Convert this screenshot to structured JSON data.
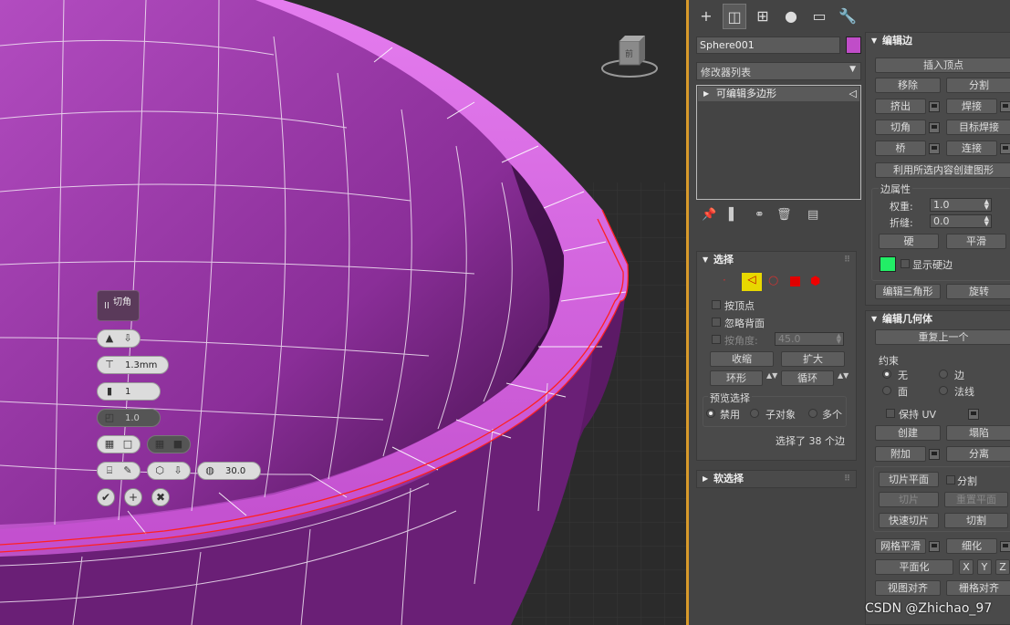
{
  "viewport": {
    "caddy_title": "切角",
    "caddy_pause": "II",
    "amount_value": "1.3mm",
    "segments_value": "1",
    "tension_value": "1.0",
    "threshold_value": "30.0",
    "nav_cube_label": "前"
  },
  "tabs": [
    "+",
    "修改",
    "层次",
    "运动",
    "显示",
    "工具"
  ],
  "object": {
    "name": "Sphere001",
    "color": "#c04dc8"
  },
  "modifier_list": {
    "label": "修改器列表"
  },
  "stack": {
    "item": "可编辑多边形"
  },
  "edit_edges": {
    "title": "编辑边",
    "insert_vertex": "插入顶点",
    "remove": "移除",
    "split": "分割",
    "extrude": "挤出",
    "weld": "焊接",
    "chamfer": "切角",
    "target_weld": "目标焊接",
    "bridge": "桥",
    "connect": "连接",
    "create_shape": "利用所选内容创建图形",
    "edge_props": "边属性",
    "weight_label": "权重:",
    "weight_value": "1.0",
    "crease_label": "折缝:",
    "crease_value": "0.0",
    "hard": "硬",
    "smooth": "平滑",
    "display_hard": "显示硬边",
    "hard_color": "#22ee66",
    "edit_tri": "编辑三角形",
    "turn": "旋转"
  },
  "edit_geometry": {
    "title": "编辑几何体",
    "repeat_last": "重复上一个",
    "constraints": "约束",
    "c_none": "无",
    "c_edge": "边",
    "c_face": "面",
    "c_normal": "法线",
    "preserve_uv": "保持 UV",
    "create": "创建",
    "collapse": "塌陷",
    "attach": "附加",
    "detach": "分离",
    "slice_plane": "切片平面",
    "split": "分割",
    "slice": "切片",
    "reset_plane": "重置平面",
    "quickslice": "快速切片",
    "cut": "切割",
    "meshsmooth": "网格平滑",
    "tessellate": "细化",
    "make_planar": "平面化",
    "x": "X",
    "y": "Y",
    "z": "Z",
    "view_align": "视图对齐",
    "grid_align": "栅格对齐"
  },
  "selection": {
    "title": "选择",
    "by_vertex": "按顶点",
    "ignore_backfacing": "忽略背面",
    "by_angle": "按角度:",
    "angle_value": "45.0",
    "shrink": "收缩",
    "grow": "扩大",
    "ring": "环形",
    "loop": "循环",
    "preview_title": "预览选择",
    "p_off": "禁用",
    "p_subobj": "子对象",
    "p_multi": "多个",
    "status": "选择了 38 个边"
  },
  "soft_selection": {
    "title": "软选择"
  },
  "watermark": "CSDN @Zhichao_97",
  "colors": {
    "accent": "#d89a2a",
    "mesh": "#c04dc8",
    "selected_edge": "#ff2020",
    "arrow": "#e22222"
  }
}
